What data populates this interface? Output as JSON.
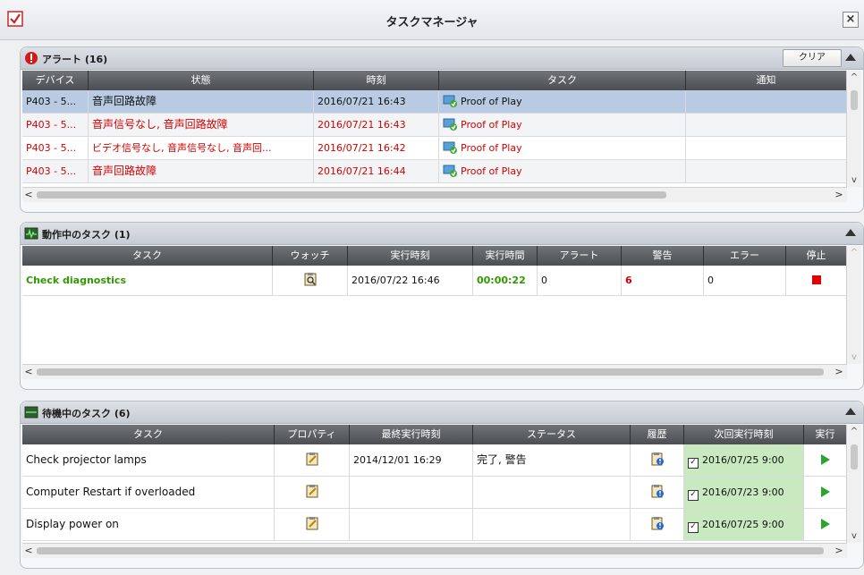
{
  "window": {
    "title": "タスクマネージャ",
    "close_glyph": "×"
  },
  "alerts": {
    "title": "アラート (16)",
    "clear_label": "クリア",
    "columns": [
      "デバイス",
      "状態",
      "時刻",
      "タスク",
      "通知"
    ],
    "rows": [
      {
        "device": "P403 - 5...",
        "state": "音声回路故障",
        "time": "2016/07/21 16:43",
        "task": "Proof of Play",
        "notice": ""
      },
      {
        "device": "P403 - 5...",
        "state": "音声信号なし, 音声回路故障",
        "time": "2016/07/21 16:43",
        "task": "Proof of Play",
        "notice": ""
      },
      {
        "device": "P403 - 5...",
        "state": "ビデオ信号なし, 音声信号なし, 音声回...",
        "time": "2016/07/21 16:42",
        "task": "Proof of Play",
        "notice": ""
      },
      {
        "device": "P403 - 5...",
        "state": "音声回路故障",
        "time": "2016/07/21 16:44",
        "task": "Proof of Play",
        "notice": ""
      }
    ]
  },
  "running": {
    "title": "動作中のタスク (1)",
    "columns": [
      "タスク",
      "ウォッチ",
      "実行時刻",
      "実行時間",
      "アラート",
      "警告",
      "エラー",
      "停止"
    ],
    "rows": [
      {
        "task": "Check diagnostics",
        "start": "2016/07/22 16:46",
        "elapsed": "00:00:22",
        "alerts": "0",
        "warnings": "6",
        "errors": "0"
      }
    ]
  },
  "waiting": {
    "title": "待機中のタスク (6)",
    "columns": [
      "タスク",
      "プロパティ",
      "最終実行時刻",
      "ステータス",
      "履歴",
      "次回実行時刻",
      "実行"
    ],
    "rows": [
      {
        "task": "Check projector lamps",
        "last": "2014/12/01 16:29",
        "status": "完了, 警告",
        "next": "2016/07/25 9:00"
      },
      {
        "task": "Computer Restart if overloaded",
        "last": "",
        "status": "",
        "next": "2016/07/23 9:00"
      },
      {
        "task": "Display power on",
        "last": "",
        "status": "",
        "next": "2016/07/25 9:00"
      }
    ]
  },
  "colors": {
    "header_bg": "#5a5e62",
    "alert_red": "#d40000",
    "running_green": "#2e9a00",
    "selected_row": "#b9cbe3",
    "next_run_bg": "#c9eac0"
  }
}
